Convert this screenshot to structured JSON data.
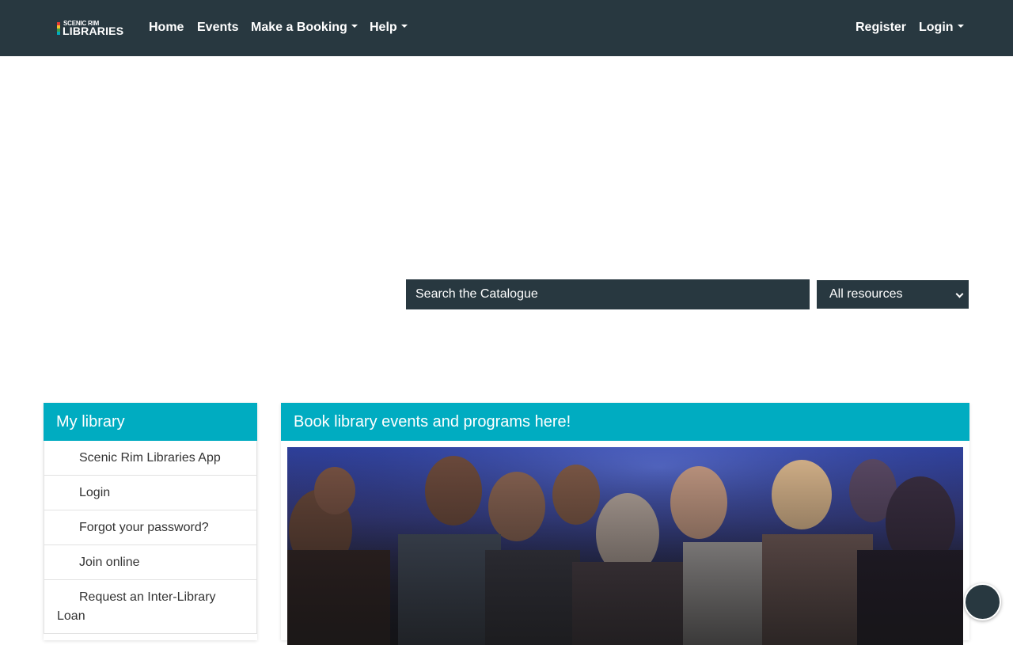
{
  "brand": {
    "logo_small": "SCENIC RIM",
    "logo_big": "LIBRARIES",
    "logo_bar_colors": [
      "#e53935",
      "#fbc02d",
      "#43a047",
      "#00acc1"
    ]
  },
  "nav": {
    "home": "Home",
    "events": "Events",
    "booking": "Make a Booking",
    "help": "Help",
    "register": "Register",
    "login": "Login"
  },
  "search": {
    "placeholder": "Search the Catalogue",
    "scope_selected": "All resources"
  },
  "my_library": {
    "title": "My library",
    "items": [
      "Scenic Rim Libraries App",
      "Login",
      "Forgot your password?",
      "Join online",
      "Request an Inter-Library Loan"
    ]
  },
  "events_panel": {
    "title": "Book library events and programs here!"
  },
  "colors": {
    "navbar": "#283840",
    "accent": "#00acc1"
  }
}
